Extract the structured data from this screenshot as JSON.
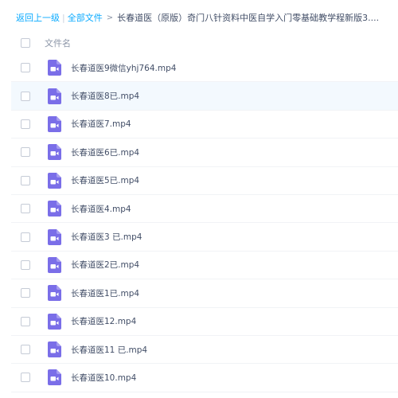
{
  "breadcrumb": {
    "back": "返回上一级",
    "all_files": "全部文件",
    "current": "长春道医（原版）奇门八针资料中医自学入门零基础教学程新版3...."
  },
  "header": {
    "column_name": "文件名"
  },
  "files": [
    {
      "name": "长春道医9微信yhj764.mp4"
    },
    {
      "name": "长春道医8已.mp4"
    },
    {
      "name": "长春道医7.mp4"
    },
    {
      "name": "长春道医6已.mp4"
    },
    {
      "name": "长春道医5已.mp4"
    },
    {
      "name": "长春道医4.mp4"
    },
    {
      "name": "长春道医3 已.mp4"
    },
    {
      "name": "长春道医2已.mp4"
    },
    {
      "name": "长春道医1已.mp4"
    },
    {
      "name": "长春道医12.mp4"
    },
    {
      "name": "长春道医11 已.mp4"
    },
    {
      "name": "长春道医10.mp4"
    }
  ],
  "colors": {
    "link": "#09aaff",
    "icon": "#7a6ee8",
    "highlight_row": "#f3f9fe"
  },
  "icons": {
    "file": "video-file-icon"
  }
}
